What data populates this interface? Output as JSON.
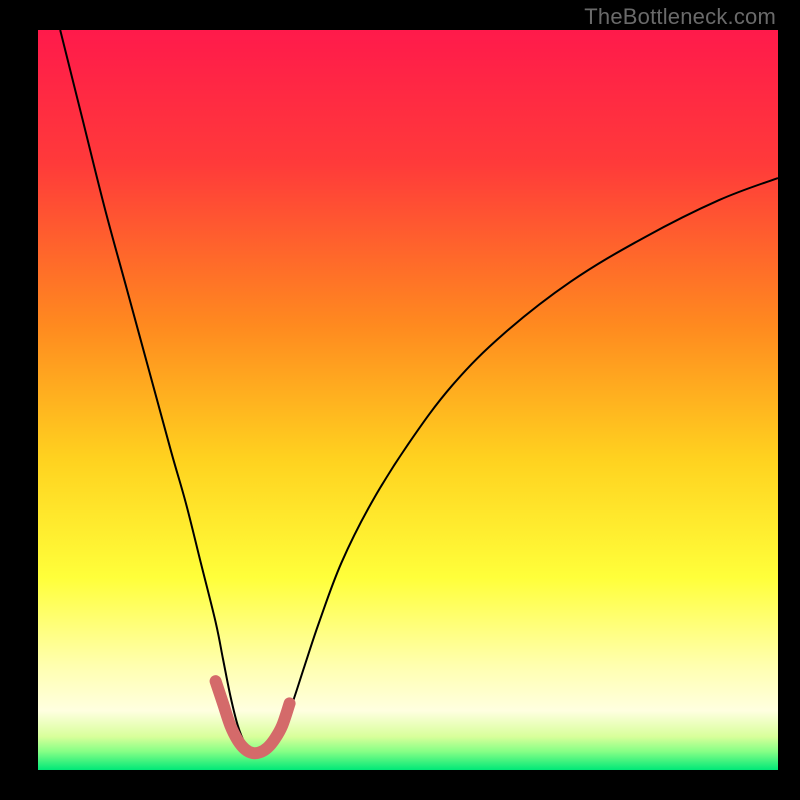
{
  "watermark": "TheBottleneck.com",
  "chart_data": {
    "type": "line",
    "title": "",
    "xlabel": "",
    "ylabel": "",
    "xlim": [
      0,
      100
    ],
    "ylim": [
      0,
      100
    ],
    "grid": false,
    "legend": null,
    "gradient_stops": [
      {
        "offset": 0.0,
        "color": "#ff1a4b"
      },
      {
        "offset": 0.18,
        "color": "#ff3a3a"
      },
      {
        "offset": 0.4,
        "color": "#ff8a1f"
      },
      {
        "offset": 0.58,
        "color": "#ffd21f"
      },
      {
        "offset": 0.74,
        "color": "#ffff3a"
      },
      {
        "offset": 0.86,
        "color": "#ffffb0"
      },
      {
        "offset": 0.92,
        "color": "#ffffe0"
      },
      {
        "offset": 0.955,
        "color": "#d8ff9a"
      },
      {
        "offset": 0.975,
        "color": "#86ff86"
      },
      {
        "offset": 1.0,
        "color": "#00e878"
      }
    ],
    "series": [
      {
        "name": "bottleneck-curve",
        "color": "#000000",
        "stroke_width": 2,
        "x": [
          3,
          6,
          9,
          12,
          15,
          18,
          20,
          22,
          24,
          25,
          26,
          27,
          28,
          29,
          30,
          31,
          32,
          34,
          36,
          38,
          41,
          45,
          50,
          56,
          63,
          72,
          82,
          92,
          100
        ],
        "y": [
          100,
          88,
          76,
          65,
          54,
          43,
          36,
          28,
          20,
          15,
          10,
          6,
          3.5,
          2.2,
          2.0,
          2.2,
          3.5,
          8,
          14,
          20,
          28,
          36,
          44,
          52,
          59,
          66,
          72,
          77,
          80
        ]
      },
      {
        "name": "valley-highlight",
        "color": "#d46a6a",
        "stroke_width": 12,
        "linecap": "round",
        "x": [
          24,
          25,
          26,
          27,
          28,
          29,
          30,
          31,
          32,
          33,
          34
        ],
        "y": [
          12,
          9,
          6,
          4,
          2.8,
          2.3,
          2.4,
          3.0,
          4.2,
          6,
          9
        ]
      }
    ]
  }
}
